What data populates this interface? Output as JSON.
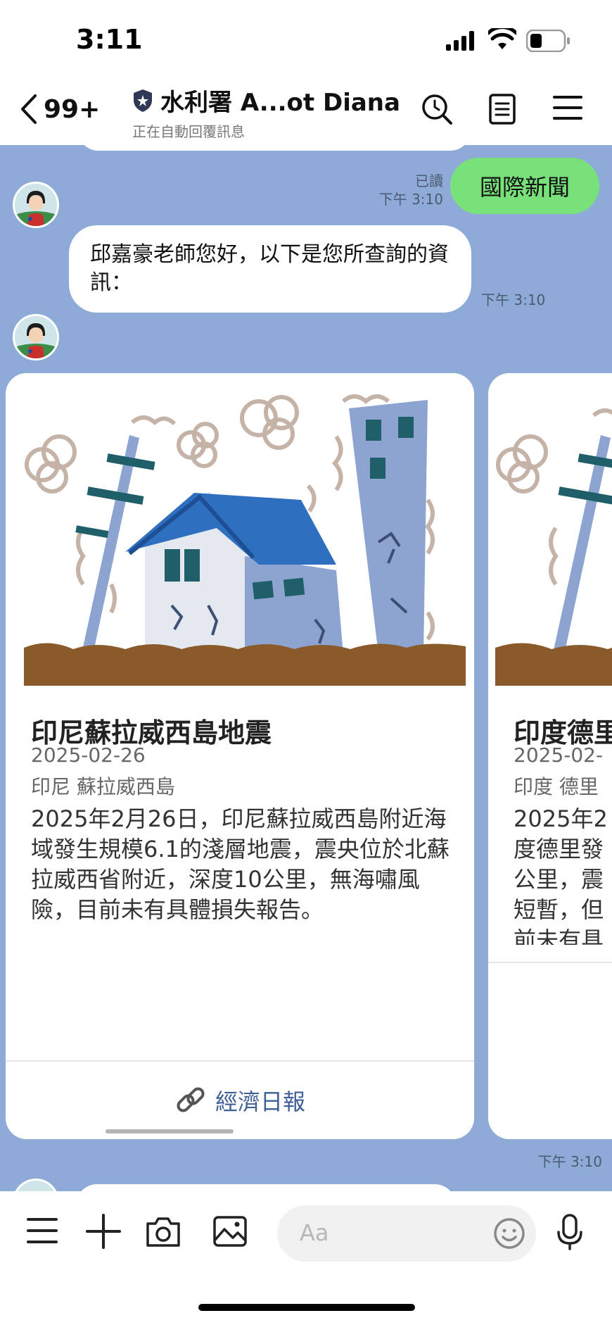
{
  "status_bar": {
    "time": "3:11"
  },
  "header": {
    "back_count": "99+",
    "title": "水利署 A...ot Diana",
    "subtitle": "正在自動回覆訊息"
  },
  "messages": {
    "sent": {
      "text": "國際新聞",
      "read": "已讀",
      "time": "下午 3:10"
    },
    "received": {
      "text": "邱嘉豪老師您好，以下是您所查詢的資訊：",
      "time": "下午 3:10"
    }
  },
  "cards": [
    {
      "title": "印尼蘇拉威西島地震",
      "date": "2025-02-26",
      "location": "印尼 蘇拉威西島",
      "body": "2025年2月26日，印尼蘇拉威西島附近海域發生規模6.1的淺層地震，震央位於北蘇拉威西省附近，深度10公里，無海嘯風險，目前未有具體損失報告。",
      "link": "經濟日報"
    },
    {
      "title": "印度德里",
      "date": "2025-02-",
      "location": "印度 德里",
      "body_lines": [
        "2025年2",
        "度德里發",
        "公里，震",
        "短暫，但",
        "前未有具"
      ]
    }
  ],
  "carousel_time": "下午 3:10",
  "input": {
    "placeholder": "Aa"
  },
  "colors": {
    "chat_bg": "#8eaad6",
    "sent_bubble": "#79e17a",
    "link": "#3d5e96"
  }
}
